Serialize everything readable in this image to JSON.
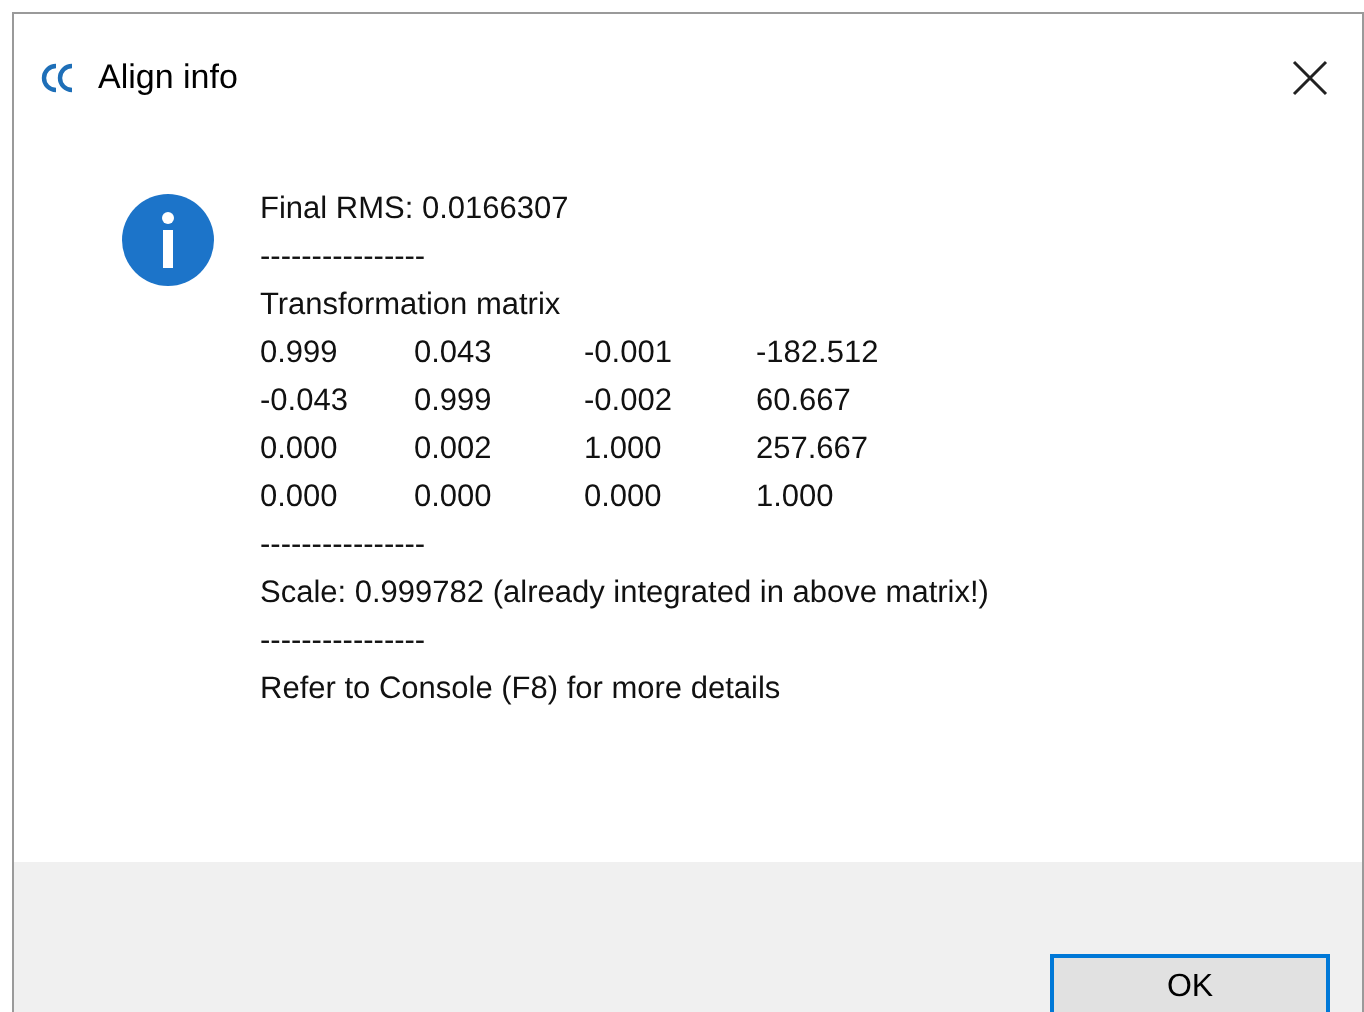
{
  "window": {
    "title": "Align info"
  },
  "lines": [
    {
      "kind": "text",
      "text": "Final RMS: 0.0166307"
    },
    {
      "kind": "text",
      "text": "----------------"
    },
    {
      "kind": "text",
      "text": "Transformation matrix"
    },
    {
      "kind": "row",
      "cells": [
        "0.999",
        "0.043",
        "-0.001",
        "-182.512"
      ]
    },
    {
      "kind": "row",
      "cells": [
        "-0.043",
        "0.999",
        "-0.002",
        "60.667"
      ]
    },
    {
      "kind": "row",
      "cells": [
        "0.000",
        "0.002",
        "1.000",
        "257.667"
      ]
    },
    {
      "kind": "row",
      "cells": [
        "0.000",
        "0.000",
        "0.000",
        "1.000"
      ]
    },
    {
      "kind": "text",
      "text": "----------------"
    },
    {
      "kind": "text",
      "text": "Scale: 0.999782 (already integrated in above matrix!)"
    },
    {
      "kind": "text",
      "text": "----------------"
    },
    {
      "kind": "text",
      "text": "Refer to Console (F8) for more details"
    }
  ],
  "buttons": [
    {
      "label": "OK"
    }
  ]
}
